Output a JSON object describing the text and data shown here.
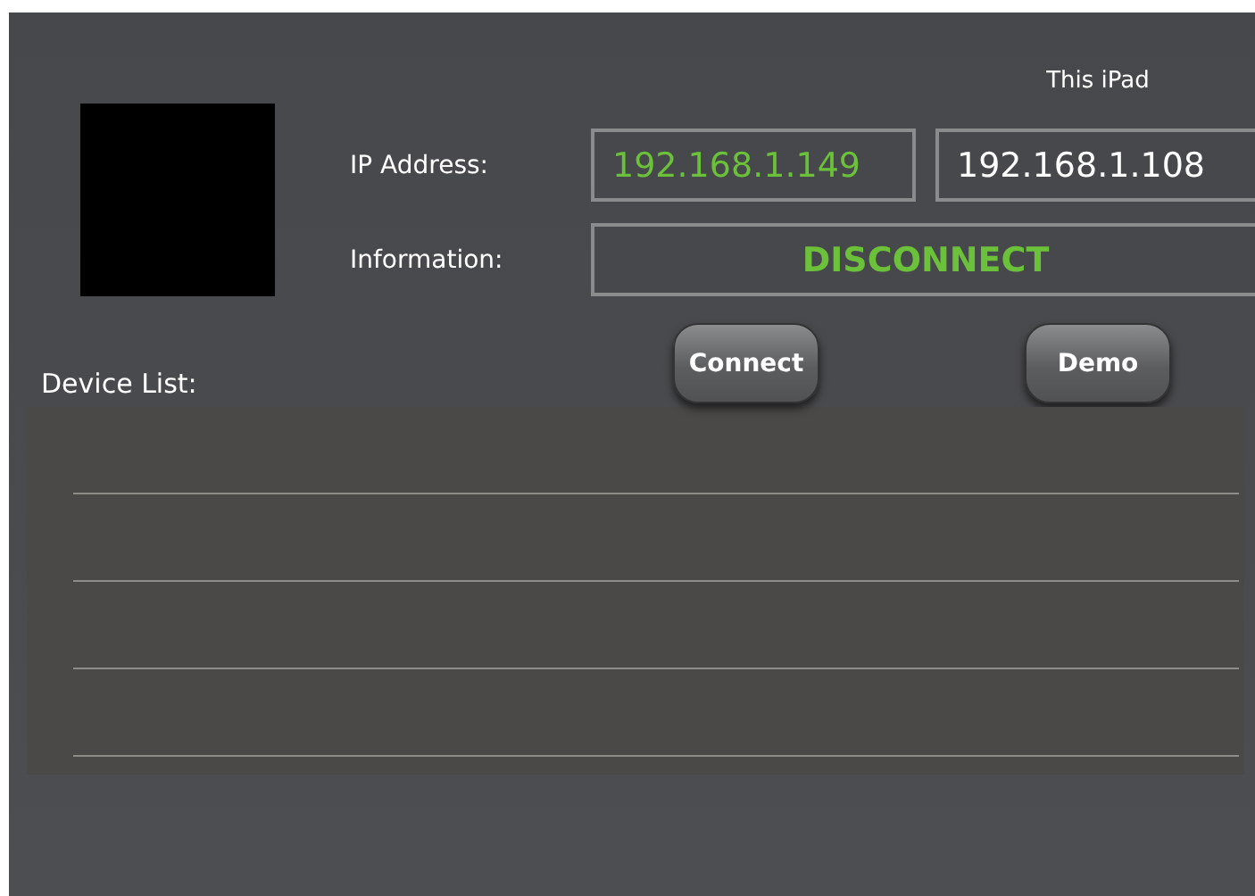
{
  "this_device": {
    "label": "This iPad"
  },
  "ip_address": {
    "label": "IP Address:",
    "target_value": "192.168.1.149",
    "this_device_value": "192.168.1.108"
  },
  "information": {
    "label": "Information:",
    "value": "DISCONNECT"
  },
  "buttons": [
    {
      "label": "Connect"
    },
    {
      "label": "Demo"
    }
  ],
  "device_list": {
    "label": "Device List:"
  }
}
